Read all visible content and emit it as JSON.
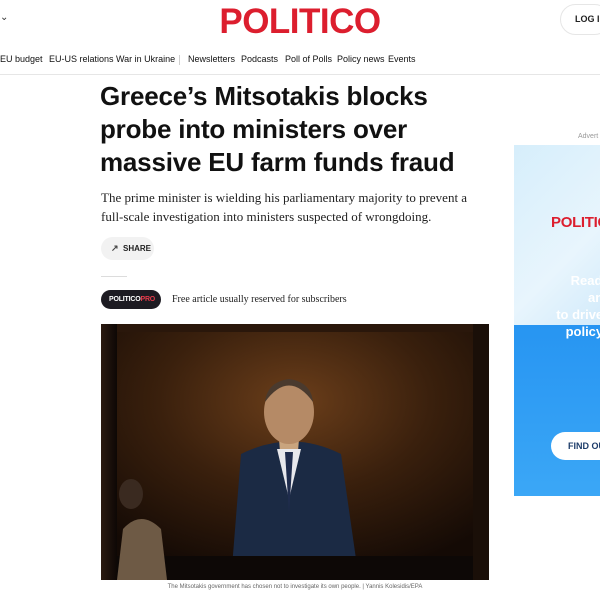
{
  "header": {
    "chevron": "⌄",
    "logo": "POLITICO",
    "login_label": "LOG IN"
  },
  "nav": {
    "items": [
      "EU budget",
      "EU-US relations",
      "War in Ukraine",
      "Newsletters",
      "Podcasts",
      "Poll of Polls",
      "Policy news",
      "Events"
    ]
  },
  "article": {
    "headline": "Greece’s Mitsotakis blocks probe into ministers over massive EU farm funds fraud",
    "dek": "The prime minister is wielding his parliamentary majority to prevent a full-scale investigation into ministers suspected of wrongdoing.",
    "share_label": "SHARE",
    "share_icon": "↗",
    "pro_badge_brand": "POLITICO",
    "pro_badge_tier": "PRO",
    "pro_note": "Free article usually reserved for subscribers",
    "caption": "The Mitsotakis government has chosen not to investigate its own people. | Yannis Kolesidis/EPA"
  },
  "ad": {
    "label": "Advert",
    "logo": "POLITIC",
    "text": "Ready-\nanal\nto drive y\npolicy c",
    "button": "FIND OU"
  },
  "colors": {
    "brand_red": "#dc1e2e",
    "ad_blue": "#1f8ff0",
    "badge_dark": "#1d1b22"
  }
}
